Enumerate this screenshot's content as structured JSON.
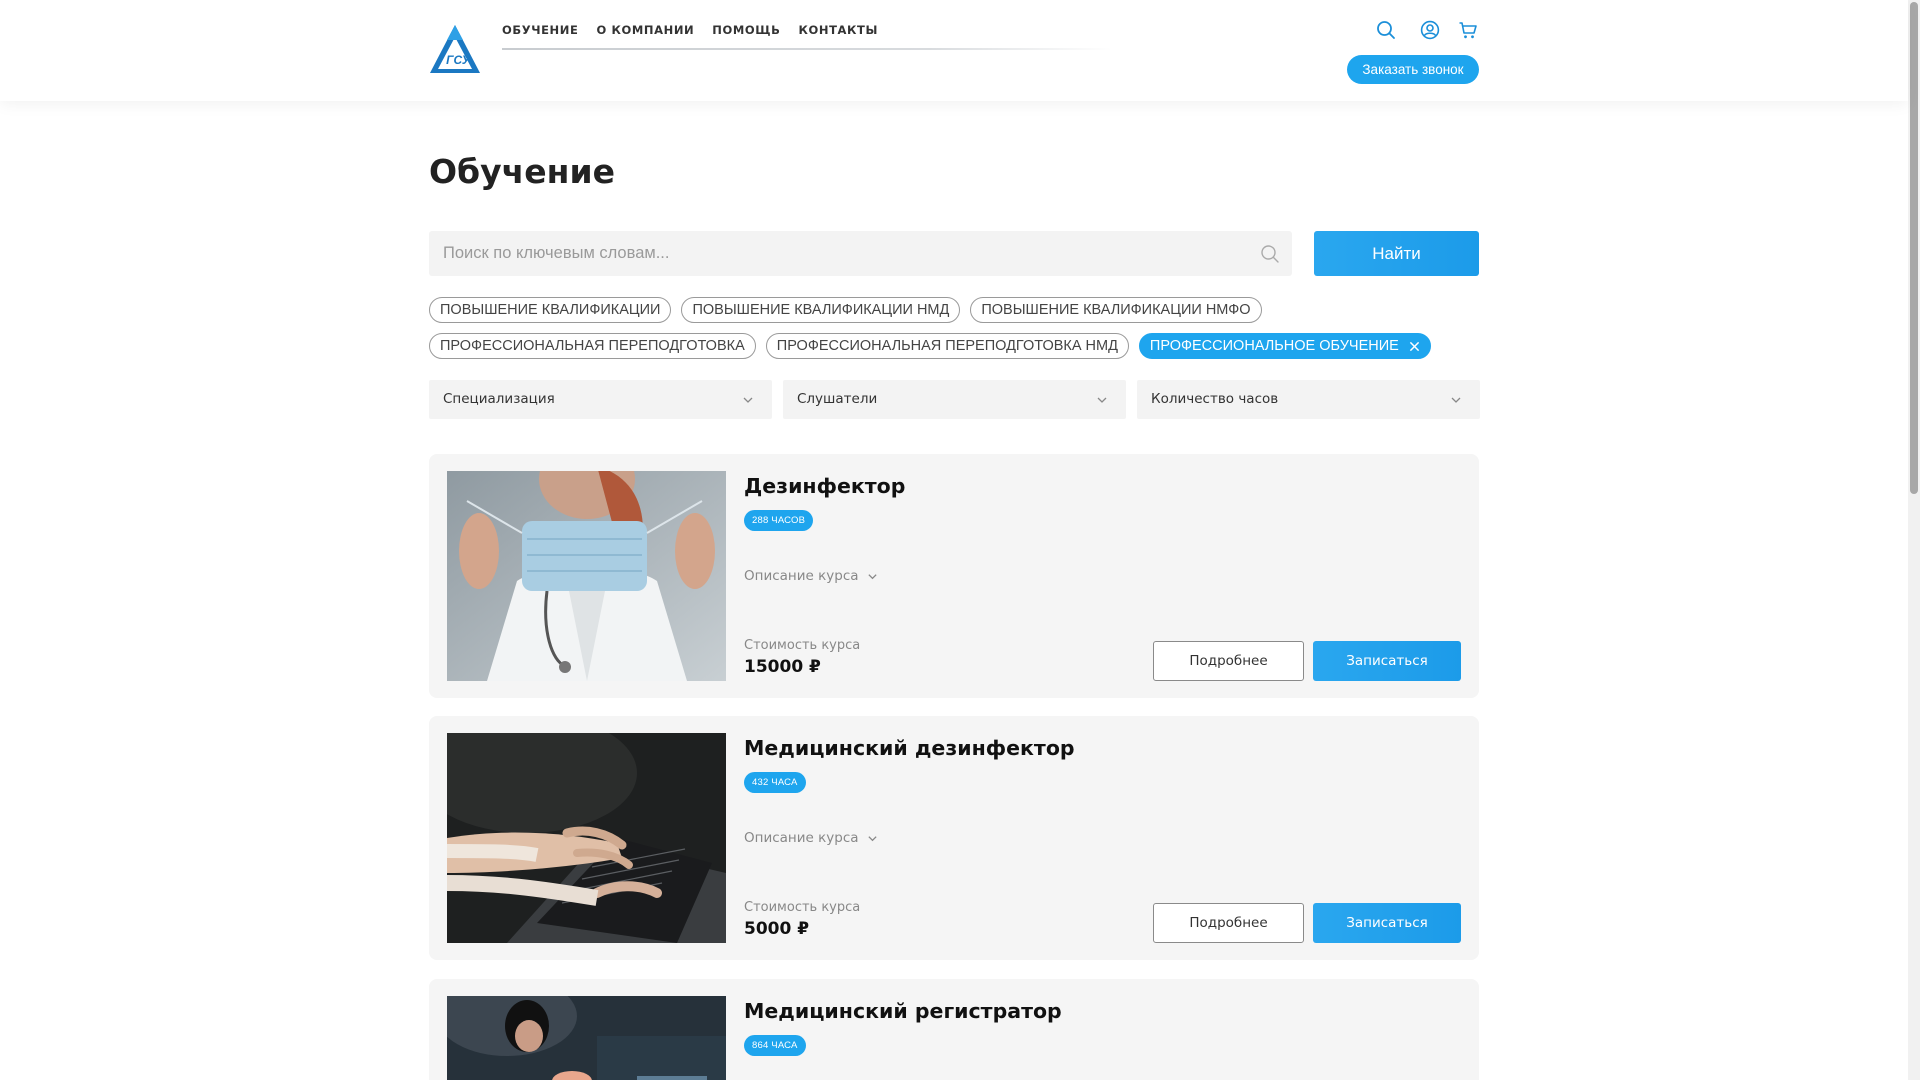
{
  "header": {
    "nav": [
      "ОБУЧЕНИЕ",
      "О КОМПАНИИ",
      "ПОМОЩЬ",
      "КОНТАКТЫ"
    ],
    "logo_text": "ГСУ",
    "callback_label": "Заказать звонок",
    "icons": [
      "search-icon",
      "user-icon",
      "cart-icon"
    ]
  },
  "page": {
    "title": "Обучение",
    "search": {
      "placeholder": "Поиск по ключевым словам...",
      "button": "Найти"
    },
    "chips_row1": [
      "ПОВЫШЕНИЕ КВАЛИФИКАЦИИ",
      "ПОВЫШЕНИЕ КВАЛИФИКАЦИИ НМД",
      "ПОВЫШЕНИЕ КВАЛИФИКАЦИИ НМФО"
    ],
    "chips_row2": [
      "ПРОФЕССИОНАЛЬНАЯ ПЕРЕПОДГОТОВКА",
      "ПРОФЕССИОНАЛЬНАЯ ПЕРЕПОДГОТОВКА НМД"
    ],
    "active_chip": "ПРОФЕССИОНАЛЬНОЕ ОБУЧЕНИЕ",
    "filters": [
      "Специализация",
      "Слушатели",
      "Количество часов"
    ]
  },
  "courses": [
    {
      "title": "Дезинфектор",
      "hours": "288 ЧАСОВ",
      "desc_label": "Описание курса",
      "price_label": "Стоимость курса",
      "price": "15000 ₽",
      "more_label": "Подробнее",
      "enroll_label": "Записаться"
    },
    {
      "title": "Медицинский дезинфектор",
      "hours": "432 ЧАСА",
      "desc_label": "Описание курса",
      "price_label": "Стоимость курса",
      "price": "5000 ₽",
      "more_label": "Подробнее",
      "enroll_label": "Записаться"
    },
    {
      "title": "Медицинский регистратор",
      "hours": "864 ЧАСА"
    }
  ],
  "colors": {
    "accent": "#1ea5ee",
    "card_bg": "#f5f5f5",
    "logo_blue": "#1b6fb5"
  }
}
